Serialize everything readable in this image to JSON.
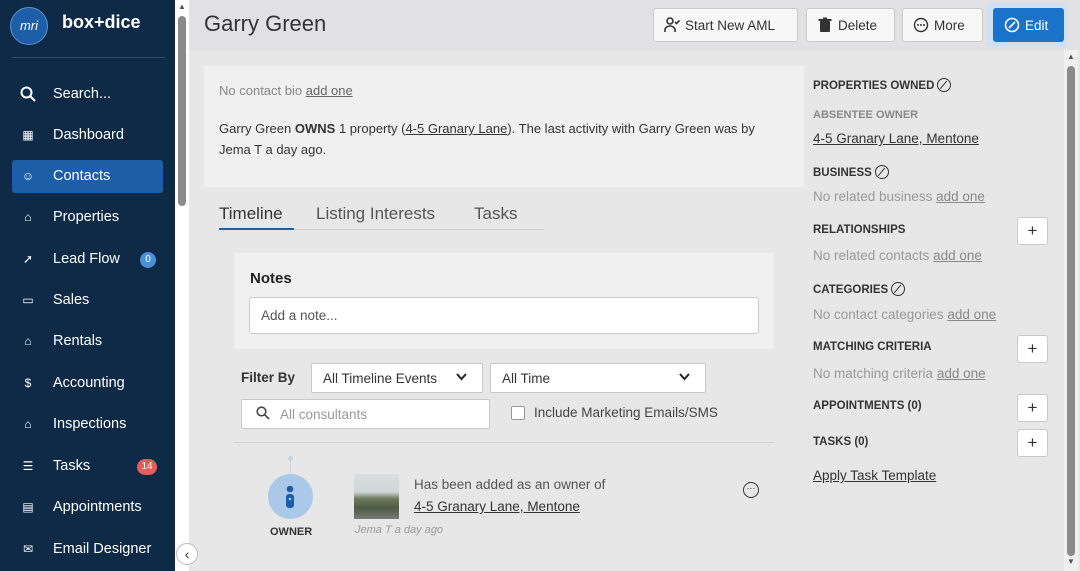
{
  "brand": {
    "logo_mark": "mri",
    "name": "box+dice"
  },
  "sidebar": {
    "items": [
      {
        "label": "Search...",
        "icon": "search-icon",
        "glyph": "⚲"
      },
      {
        "label": "Dashboard",
        "icon": "dashboard-icon",
        "glyph": "▦"
      },
      {
        "label": "Contacts",
        "icon": "contacts-icon",
        "glyph": "☺"
      },
      {
        "label": "Properties",
        "icon": "home-icon",
        "glyph": "⌂"
      },
      {
        "label": "Lead Flow",
        "icon": "lead-flow-icon",
        "glyph": "➚",
        "badge": "0"
      },
      {
        "label": "Sales",
        "icon": "sales-icon",
        "glyph": "▭"
      },
      {
        "label": "Rentals",
        "icon": "rentals-icon",
        "glyph": "⌂"
      },
      {
        "label": "Accounting",
        "icon": "dollar-icon",
        "glyph": "$"
      },
      {
        "label": "Inspections",
        "icon": "inspections-icon",
        "glyph": "⌂"
      },
      {
        "label": "Tasks",
        "icon": "tasks-icon",
        "glyph": "☰",
        "badge": "14"
      },
      {
        "label": "Appointments",
        "icon": "calendar-icon",
        "glyph": "▤"
      },
      {
        "label": "Email Designer",
        "icon": "email-icon",
        "glyph": "✉"
      }
    ],
    "active": "Contacts",
    "collapse_glyph": "‹"
  },
  "header": {
    "title": "Garry Green",
    "buttons": {
      "aml": "Start New AML",
      "delete": "Delete",
      "more": "More",
      "edit": "Edit"
    }
  },
  "bio": {
    "empty_text": "No contact bio",
    "add_link": "add one",
    "owns_prefix": "Garry Green",
    "owns_bold": "OWNS",
    "owns_mid": "1 property (",
    "owns_link": "4-5 Granary Lane",
    "owns_suffix": "). The last activity with Garry Green was by Jema T a day ago."
  },
  "tabs": [
    "Timeline",
    "Listing Interests",
    "Tasks"
  ],
  "notes": {
    "title": "Notes",
    "placeholder": "Add a note..."
  },
  "filters": {
    "label": "Filter By",
    "events_select": "All Timeline Events",
    "time_select": "All Time",
    "consultants_placeholder": "All consultants",
    "include_marketing": "Include Marketing Emails/SMS"
  },
  "timeline_event": {
    "role": "OWNER",
    "text": "Has been added as an owner of",
    "link": "4-5 Granary Lane, Mentone",
    "meta": "Jema T a day ago"
  },
  "right_panel": {
    "properties_owned": "PROPERTIES OWNED",
    "absentee_owner": "ABSENTEE OWNER",
    "property_link": "4-5 Granary Lane, Mentone",
    "business": "BUSINESS",
    "business_empty": "No related business",
    "relationships": "RELATIONSHIPS",
    "relationships_empty": "No related contacts",
    "categories": "CATEGORIES",
    "categories_empty": "No contact categories",
    "matching": "MATCHING CRITERIA",
    "matching_empty": "No matching criteria",
    "appointments": "APPOINTMENTS (0)",
    "tasks": "TASKS (0)",
    "apply_template": "Apply Task Template",
    "add_one": "add one"
  },
  "colors": {
    "sidebar_bg": "#0f2a47",
    "accent": "#1a73c9",
    "badge_red": "#e85b5b",
    "badge_blue": "#4a90d9"
  }
}
